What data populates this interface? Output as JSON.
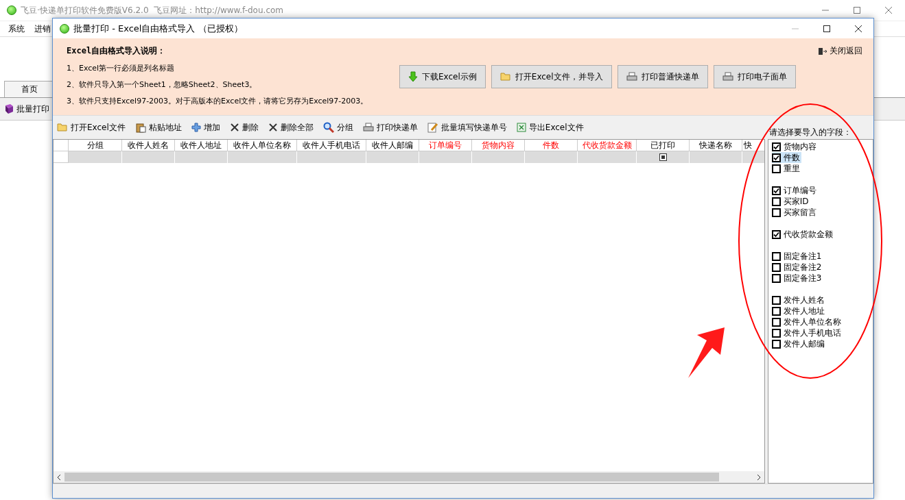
{
  "main_window": {
    "title": "飞豆·快递单打印软件免费版V6.2.0  飞豆网址：http://www.f-dou.com",
    "menu": [
      "系统",
      "进销"
    ],
    "tabs": [
      "首页"
    ],
    "sidebar_item": "批量打印"
  },
  "dialog": {
    "title": "批量打印 - Excel自由格式导入 （已授权）",
    "info": {
      "heading": "Excel自由格式导入说明：",
      "lines": [
        "1、Excel第一行必须是列名标题",
        "2、软件只导入第一个Sheet1，忽略Sheet2、Sheet3。",
        "3、软件只支持Excel97-2003。对于高版本的Excel文件，请将它另存为Excel97-2003。"
      ],
      "close_link": "关闭返回"
    },
    "action_buttons": [
      {
        "kind": "download",
        "label": "下载Excel示例"
      },
      {
        "kind": "open",
        "label": "打开Excel文件，并导入"
      },
      {
        "kind": "print",
        "label": "打印普通快递单"
      },
      {
        "kind": "print",
        "label": "打印电子面单"
      }
    ],
    "toolbar": [
      {
        "kind": "open",
        "label": "打开Excel文件"
      },
      {
        "kind": "paste",
        "label": "粘贴地址"
      },
      {
        "kind": "add",
        "label": "增加"
      },
      {
        "kind": "delete",
        "label": "删除"
      },
      {
        "kind": "delete",
        "label": "删除全部"
      },
      {
        "kind": "search",
        "label": "分组"
      },
      {
        "kind": "print",
        "label": "打印快递单"
      },
      {
        "kind": "edit",
        "label": "批量填写快递单号"
      },
      {
        "kind": "excel",
        "label": "导出Excel文件"
      }
    ],
    "table": {
      "columns": [
        {
          "label": "分组",
          "required": false
        },
        {
          "label": "收件人姓名",
          "required": false
        },
        {
          "label": "收件人地址",
          "required": false
        },
        {
          "label": "收件人单位名称",
          "required": false
        },
        {
          "label": "收件人手机电话",
          "required": false
        },
        {
          "label": "收件人邮编",
          "required": false
        },
        {
          "label": "订单编号",
          "required": true
        },
        {
          "label": "货物内容",
          "required": true
        },
        {
          "label": "件数",
          "required": true
        },
        {
          "label": "代收货款金额",
          "required": true
        },
        {
          "label": "已打印",
          "required": false
        },
        {
          "label": "快递名称",
          "required": false
        },
        {
          "label": "快",
          "required": false
        }
      ],
      "rows": [
        {
          "printed": true
        }
      ]
    },
    "fields": {
      "prompt": "请选择要导入的字段：",
      "groups": [
        [
          {
            "label": "货物内容",
            "checked": true,
            "selected": false
          },
          {
            "label": "件数",
            "checked": true,
            "selected": true
          },
          {
            "label": "重里",
            "checked": false,
            "selected": false
          }
        ],
        [
          {
            "label": "订单编号",
            "checked": true,
            "selected": false
          },
          {
            "label": "买家ID",
            "checked": false,
            "selected": false
          },
          {
            "label": "买家留言",
            "checked": false,
            "selected": false
          }
        ],
        [
          {
            "label": "代收货款金额",
            "checked": true,
            "selected": false
          }
        ],
        [
          {
            "label": "固定备注1",
            "checked": false,
            "selected": false
          },
          {
            "label": "固定备注2",
            "checked": false,
            "selected": false
          },
          {
            "label": "固定备注3",
            "checked": false,
            "selected": false
          }
        ],
        [
          {
            "label": "发件人姓名",
            "checked": false,
            "selected": false
          },
          {
            "label": "发件人地址",
            "checked": false,
            "selected": false
          },
          {
            "label": "发件人单位名称",
            "checked": false,
            "selected": false
          },
          {
            "label": "发件人手机电话",
            "checked": false,
            "selected": false
          },
          {
            "label": "发件人邮编",
            "checked": false,
            "selected": false
          }
        ]
      ]
    }
  }
}
